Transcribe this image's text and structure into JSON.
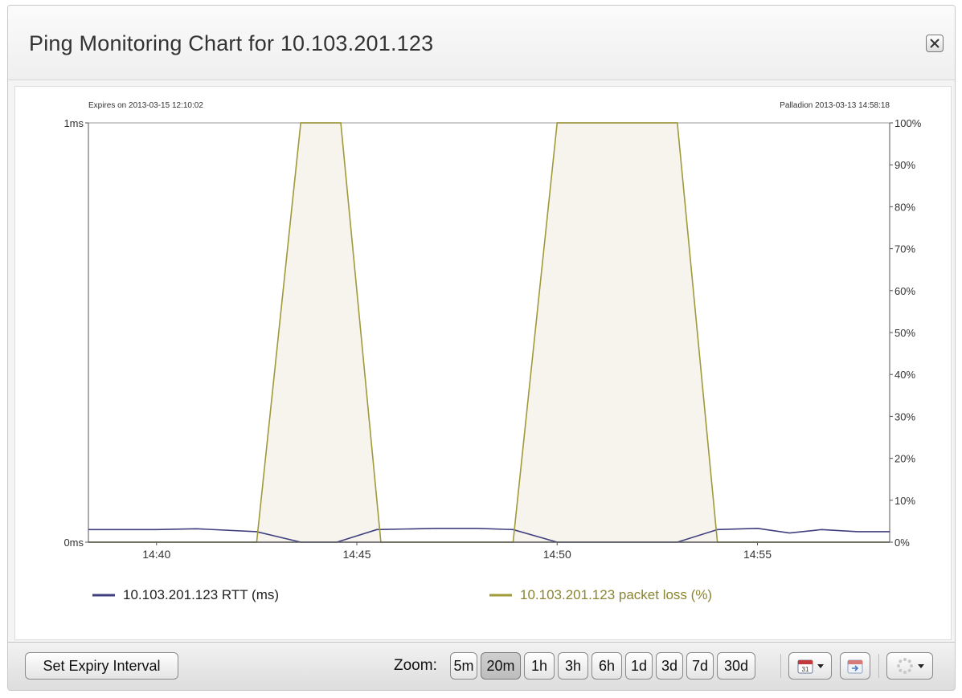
{
  "dialog": {
    "title": "Ping Monitoring Chart for 10.103.201.123"
  },
  "chart_data": {
    "type": "line",
    "top_left_note": "Expires on 2013-03-15 12:10:02",
    "top_right_note": "Palladion 2013-03-13 14:58:18",
    "x_range_minutes": [
      38.3,
      58.3
    ],
    "x_tick_values": [
      40,
      45,
      50,
      55
    ],
    "x_tick_labels": [
      "14:40",
      "14:45",
      "14:50",
      "14:55"
    ],
    "y_left": {
      "range": [
        0,
        1
      ],
      "tick_values": [
        0,
        1
      ],
      "tick_labels": [
        "0ms",
        "1ms"
      ]
    },
    "y_right": {
      "range": [
        0,
        100
      ],
      "tick_values": [
        0,
        10,
        20,
        30,
        40,
        50,
        60,
        70,
        80,
        90,
        100
      ],
      "tick_labels": [
        "0%",
        "10%",
        "20%",
        "30%",
        "40%",
        "50%",
        "60%",
        "70%",
        "80%",
        "90%",
        "100%"
      ]
    },
    "grid": false,
    "legend_position": "bottom",
    "series": [
      {
        "name": "10.103.201.123 RTT (ms)",
        "axis": "left",
        "color": "#3f3f7f",
        "x": [
          38.3,
          40,
          41,
          42.5,
          43.6,
          44.5,
          45.5,
          47,
          48,
          48.9,
          50,
          51,
          53,
          54,
          55,
          55.8,
          56.6,
          57.5,
          58.3
        ],
        "y": [
          0.03,
          0.03,
          0.032,
          0.025,
          0.0,
          0.0,
          0.03,
          0.033,
          0.033,
          0.03,
          0.0,
          0.0,
          0.0,
          0.03,
          0.033,
          0.022,
          0.03,
          0.025,
          0.025
        ]
      },
      {
        "name": "10.103.201.123 packet loss (%)",
        "axis": "right",
        "color": "#9f9a3a",
        "fill": "#f6f4ec",
        "x": [
          38.3,
          42.5,
          43.6,
          44.6,
          45.6,
          48.9,
          50,
          53,
          54,
          58.3
        ],
        "y": [
          0,
          0,
          100,
          100,
          0,
          0,
          100,
          100,
          0,
          0
        ]
      }
    ]
  },
  "toolbar": {
    "set_expiry_label": "Set Expiry Interval",
    "zoom_label": "Zoom:",
    "zoom_options": [
      "5m",
      "20m",
      "1h",
      "3h",
      "6h",
      "1d",
      "3d",
      "7d",
      "30d"
    ],
    "zoom_selected": "20m",
    "calendar_icon": "calendar-31-icon",
    "calendar_day": "31",
    "export_icon": "calendar-export-icon",
    "spinner_icon": "loading-spinner-icon"
  }
}
